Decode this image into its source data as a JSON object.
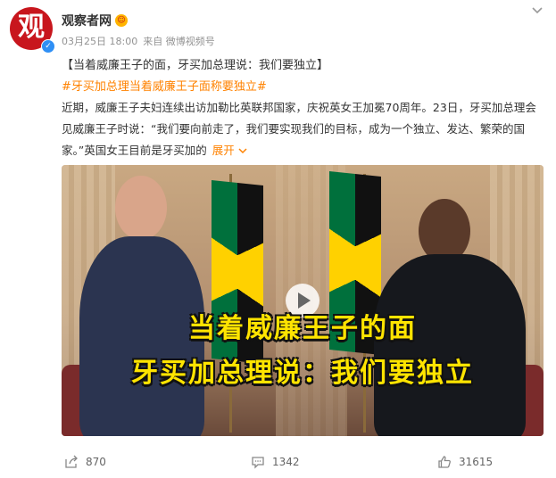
{
  "post": {
    "author": "观察者网",
    "avatar_char": "观",
    "verified_icon": "verified-check-icon",
    "badge_icon": "gold-medal-badge-icon",
    "date": "03月25日 18:00",
    "source": "来自 微博视频号",
    "headline": "【当着威廉王子的面，牙买加总理说：我们要独立】",
    "topic": "#牙买加总理当着威廉王子面称要独立#",
    "body": "近期，威廉王子夫妇连续出访加勒比英联邦国家，庆祝英女王加冕70周年。23日，牙买加总理会见威廉王子时说：“我们要向前走了，我们要实现我们的目标，成为一个独立、发达、繁荣的国家。”英国女王目前是牙买加的",
    "expand_label": "展开",
    "video": {
      "caption_line1": "当着威廉王子的面",
      "caption_line2": "牙买加总理说：我们要独立"
    }
  },
  "footer": {
    "share_count": "870",
    "comment_count": "1342",
    "like_count": "31615"
  },
  "colors": {
    "accent_orange": "#ff8200",
    "brand_red": "#c8161d",
    "caption_yellow": "#ffe400"
  }
}
